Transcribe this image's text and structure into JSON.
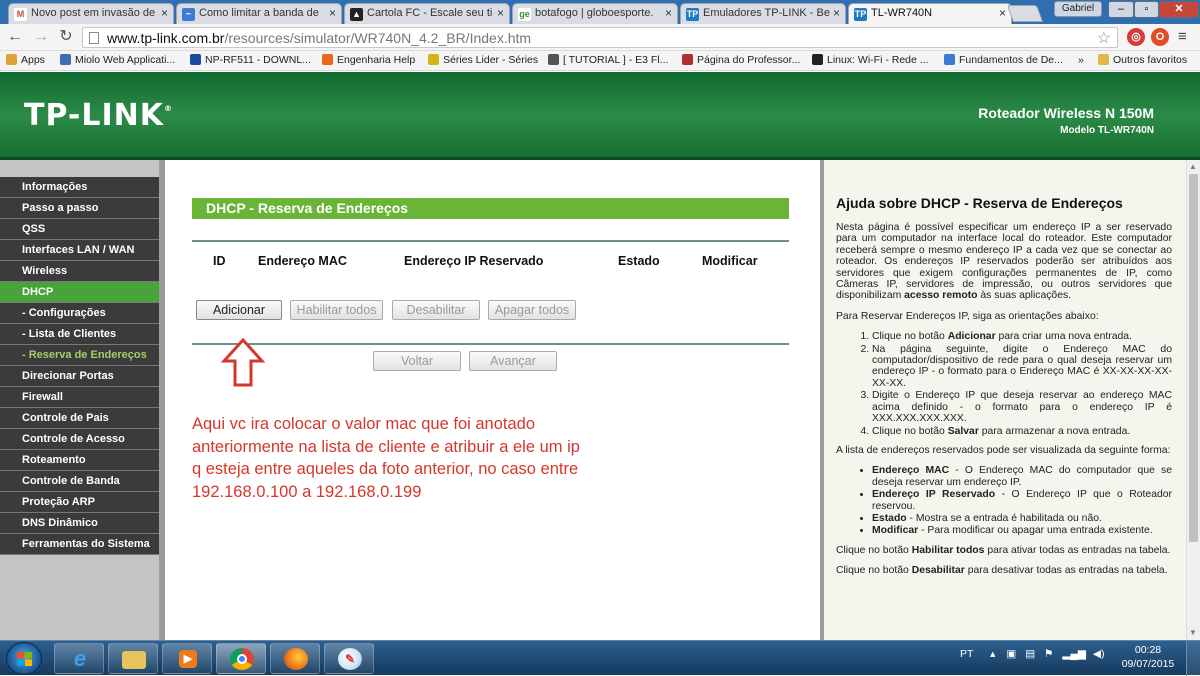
{
  "browser": {
    "tabs": [
      {
        "label": "Novo post em invasão de",
        "favicon": "gmail-icon",
        "color": "#d14836",
        "glyph": "M"
      },
      {
        "label": "Como limitar a banda de",
        "favicon": "forum-icon",
        "color": "#3a7bd5",
        "glyph": "~"
      },
      {
        "label": "Cartola FC - Escale seu ti",
        "favicon": "hat-icon",
        "color": "#222222",
        "glyph": "▲"
      },
      {
        "label": "botafogo | globoesporte.",
        "favicon": "ge-icon",
        "color": "#3c8f2c",
        "glyph": "ge"
      },
      {
        "label": "Emuladores TP-LINK - Be",
        "favicon": "tplink-icon",
        "color": "#1b7bc4",
        "glyph": "TP"
      },
      {
        "label": "TL-WR740N",
        "favicon": "tplink-icon",
        "color": "#1b7bc4",
        "glyph": "TP"
      }
    ],
    "profile_name": "Gabriel",
    "url_host": "www.tp-link.com.br",
    "url_path": "/resources/simulator/WR740N_4.2_BR/Index.htm",
    "bookmarks": [
      {
        "label": "Apps",
        "color": "#e0a23a"
      },
      {
        "label": "Miolo Web Applicati...",
        "color": "#3a6fb0"
      },
      {
        "label": "NP-RF511 - DOWNL...",
        "color": "#1a4aa0"
      },
      {
        "label": "Engenharia Help",
        "color": "#e86a1a"
      },
      {
        "label": "Séries Lider - Séries",
        "color": "#d9b21a"
      },
      {
        "label": "[ TUTORIAL ] - E3 Fl...",
        "color": "#555555"
      },
      {
        "label": "Página do Professor...",
        "color": "#b03030"
      },
      {
        "label": "Linux: Wi-Fi - Rede ...",
        "color": "#222222"
      },
      {
        "label": "Fundamentos de De...",
        "color": "#3a7bd5"
      },
      {
        "label": "»",
        "color": ""
      },
      {
        "label": "Outros favoritos",
        "color": "#e0b84a"
      }
    ]
  },
  "router": {
    "logo": "TP-LINK",
    "logo_mark": "®",
    "model_title": "Roteador Wireless N 150M",
    "model_sub": "Modelo TL-WR740N",
    "menu": [
      {
        "label": "Informações",
        "type": "main"
      },
      {
        "label": "Passo a passo",
        "type": "main"
      },
      {
        "label": "QSS",
        "type": "main"
      },
      {
        "label": "Interfaces LAN / WAN",
        "type": "main"
      },
      {
        "label": "Wireless",
        "type": "main"
      },
      {
        "label": "DHCP",
        "type": "active"
      },
      {
        "label": "- Configurações",
        "type": "sub"
      },
      {
        "label": "- Lista de Clientes",
        "type": "sub"
      },
      {
        "label": "- Reserva de Endereços",
        "type": "sub-active"
      },
      {
        "label": "Direcionar Portas",
        "type": "main"
      },
      {
        "label": "Firewall",
        "type": "main"
      },
      {
        "label": "Controle de Pais",
        "type": "main"
      },
      {
        "label": "Controle de Acesso",
        "type": "main"
      },
      {
        "label": "Roteamento",
        "type": "main"
      },
      {
        "label": "Controle de Banda",
        "type": "main"
      },
      {
        "label": "Proteção ARP",
        "type": "main"
      },
      {
        "label": "DNS Dinâmico",
        "type": "main"
      },
      {
        "label": "Ferramentas do Sistema",
        "type": "main"
      }
    ],
    "page_title": "DHCP - Reserva de Endereços",
    "columns": [
      "ID",
      "Endereço MAC",
      "Endereço IP Reservado",
      "Estado",
      "Modificar"
    ],
    "buttons": {
      "add": "Adicionar",
      "enable_all": "Habilitar todos",
      "disable": "Desabilitar",
      "delete_all": "Apagar todos",
      "back": "Voltar",
      "next": "Avançar"
    },
    "annotation": "Aqui vc ira colocar o valor mac que foi anotado anteriormente na lista de cliente e atribuir a ele um ip q esteja entre aqueles da foto anterior, no caso entre 192.168.0.100 a 192.168.0.199",
    "annotation_color": "#d4372c"
  },
  "help": {
    "title": "Ajuda sobre DHCP - Reserva de Endereços",
    "intro_a": "Nesta página é possível especificar um endereço IP a ser reservado para um computador na interface local do roteador. Este computador receberá sempre o mesmo endereço IP a cada vez que se conectar ao roteador. Os endereços IP reservados poderão ser atribuídos aos servidores que exigem configurações permanentes de IP, como Câmeras IP, servidores de impressão, ou outros servidores que disponibilizam",
    "intro_bold": "acesso remoto",
    "intro_b": "às suas aplicações.",
    "steps_intro": "Para Reservar Endereços IP, siga as orientações abaixo:",
    "step1_a": "Clique no botão",
    "step1_bold": "Adicionar",
    "step1_b": "para criar uma nova entrada.",
    "step2": "Na página seguinte, digite o Endereço MAC do computador/dispositivo de rede para o qual deseja reservar um endereço IP - o formato para o Endereço MAC é XX-XX-XX-XX-XX-XX.",
    "step3": "Digite o Endereço IP que deseja reservar ao endereço MAC acima definido - o formato para o endereço IP é XXX.XXX.XXX.XXX.",
    "step4_a": "Clique no botão",
    "step4_bold": "Salvar",
    "step4_b": "para armazenar a nova entrada.",
    "list_intro": "A lista de endereços reservados pode ser visualizada da seguinte forma:",
    "def1_term": "Endereço MAC",
    "def1_text": "- O Endereço MAC do computador que se deseja reservar um endereço IP.",
    "def2_term": "Endereço IP Reservado",
    "def2_text": "- O Endereço IP que o Roteador reservou.",
    "def3_term": "Estado",
    "def3_text": "- Mostra se a entrada é habilitada ou não.",
    "def4_term": "Modificar",
    "def4_text": "- Para modificar ou apagar uma entrada existente.",
    "p_enable_a": "Clique no botão",
    "p_enable_bold": "Habilitar todos",
    "p_enable_b": "para ativar todas as entradas na tabela.",
    "p_disable_a": "Clique no botão",
    "p_disable_bold": "Desabilitar",
    "p_disable_b": "para desativar todas as entradas na tabela."
  },
  "taskbar": {
    "language": "PT",
    "time": "00:28",
    "date": "09/07/2015"
  }
}
